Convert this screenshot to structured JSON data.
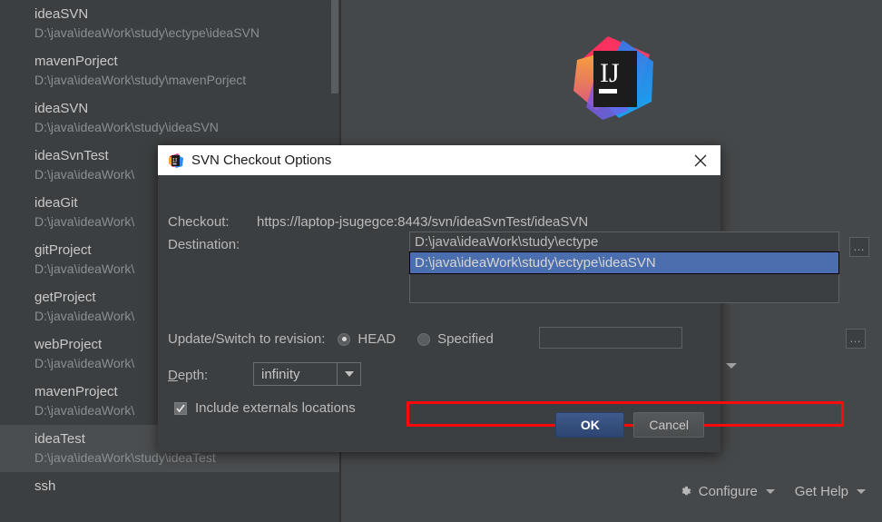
{
  "window": {
    "background": "#3c3f41",
    "logo_alt": "intellij-idea-logo"
  },
  "project_list": {
    "items": [
      {
        "name": "ideaSVN",
        "path": "D:\\java\\ideaWork\\study\\ectype\\ideaSVN",
        "selected": false
      },
      {
        "name": "mavenPorject",
        "path": "D:\\java\\ideaWork\\study\\mavenPorject",
        "selected": false
      },
      {
        "name": "ideaSVN",
        "path": "D:\\java\\ideaWork\\study\\ideaSVN",
        "selected": false
      },
      {
        "name": "ideaSvnTest",
        "path": "D:\\java\\ideaWork\\",
        "selected": false
      },
      {
        "name": "ideaGit",
        "path": "D:\\java\\ideaWork\\",
        "selected": false
      },
      {
        "name": "gitProject",
        "path": "D:\\java\\ideaWork\\",
        "selected": false
      },
      {
        "name": "getProject",
        "path": "D:\\java\\ideaWork\\",
        "selected": false
      },
      {
        "name": "webProject",
        "path": "D:\\java\\ideaWork\\",
        "selected": false
      },
      {
        "name": "mavenProject",
        "path": "D:\\java\\ideaWork\\",
        "selected": false
      },
      {
        "name": "ideaTest",
        "path": "D:\\java\\ideaWork\\study\\ideaTest",
        "selected": true
      },
      {
        "name": "ssh",
        "path": "",
        "selected": false
      }
    ]
  },
  "dialog": {
    "title": "SVN Checkout Options",
    "close_label": "✕",
    "checkout_label": "Checkout:",
    "checkout_value": "https://laptop-jsugegce:8443/svn/ideaSvnTest/ideaSVN",
    "destination_label": "Destination:",
    "destination_value": "D:\\java\\ideaWork\\study\\ectype",
    "destination_browse_label": "…",
    "destination_suggestions": [
      {
        "text": "D:\\java\\ideaWork\\study\\ectype\\ideaSVN",
        "selected": true
      }
    ],
    "revision_label": "Update/Switch to revision:",
    "revision_options": [
      {
        "label": "HEAD",
        "checked": true
      },
      {
        "label": "Specified",
        "checked": false
      }
    ],
    "revision_value": "",
    "revision_browse_label": "…",
    "depth_label_prefix": "D",
    "depth_label_rest": "epth:",
    "depth_value": "infinity",
    "include_externals_label": "Include externals locations",
    "include_externals_checked": true,
    "ok_label": "OK",
    "cancel_label": "Cancel",
    "annotation_color": "#fa0a0a",
    "selection_color": "#4b6eaf"
  },
  "welcome": {
    "configure_label": "Configure",
    "get_help_label": "Get Help"
  }
}
